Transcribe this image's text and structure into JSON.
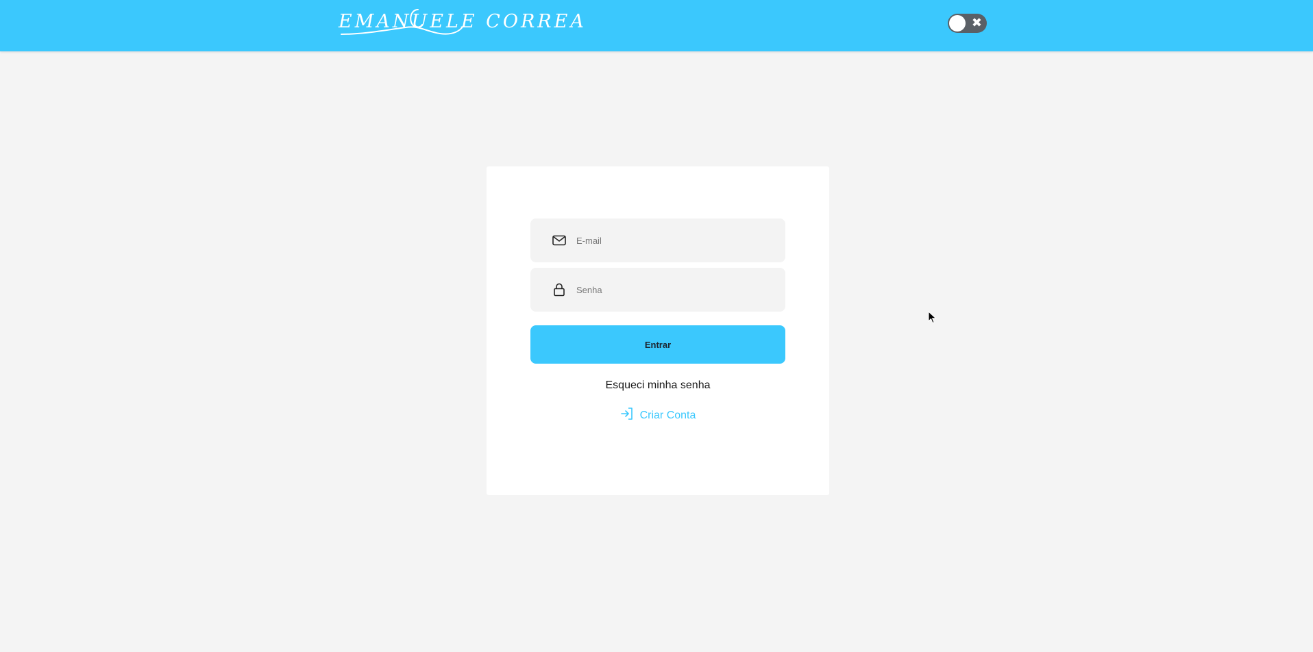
{
  "header": {
    "logo_text": "EMANUELE CORREA",
    "logo_icon": "signature-logo",
    "theme_toggle": {
      "icon": "close-icon",
      "state": "off",
      "symbol": "✖"
    }
  },
  "login": {
    "email": {
      "placeholder": "E-mail",
      "value": "",
      "icon": "mail-icon"
    },
    "password": {
      "placeholder": "Senha",
      "value": "",
      "icon": "lock-icon"
    },
    "submit_label": "Entrar",
    "forgot_label": "Esqueci minha senha",
    "create_account_label": "Criar Conta",
    "create_account_icon": "sign-in-icon"
  },
  "colors": {
    "brand": "#3bc8fd",
    "background": "#f4f4f4",
    "card": "#ffffff",
    "input_bg": "#f3f3f3",
    "toggle_track": "#5a6066"
  }
}
